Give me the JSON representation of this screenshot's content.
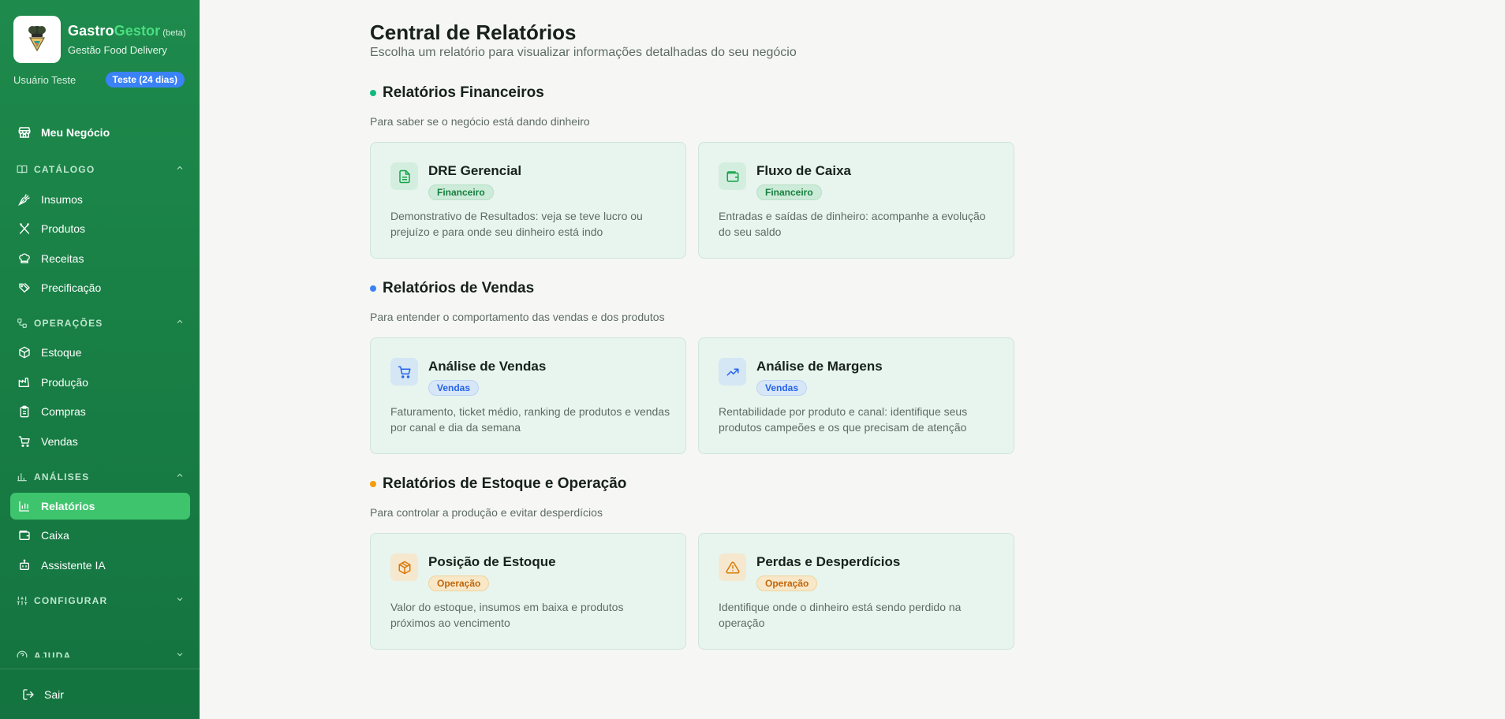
{
  "brand": {
    "name_part1": "Gastro",
    "name_part2": "Gestor",
    "beta": "(beta)",
    "subtitle": "Gestão Food Delivery"
  },
  "user": {
    "name": "Usuário Teste",
    "trial": "Teste (24 dias)"
  },
  "nav": {
    "home": "Meu Negócio",
    "catalog": {
      "title": "CATÁLOGO",
      "items": [
        "Insumos",
        "Produtos",
        "Receitas",
        "Precificação"
      ]
    },
    "operations": {
      "title": "OPERAÇÕES",
      "items": [
        "Estoque",
        "Produção",
        "Compras",
        "Vendas"
      ]
    },
    "analysis": {
      "title": "ANÁLISES",
      "items": [
        "Relatórios",
        "Caixa",
        "Assistente IA"
      ]
    },
    "configure": {
      "title": "CONFIGURAR"
    },
    "help": {
      "title": "AJUDA"
    },
    "logout": "Sair"
  },
  "page": {
    "title": "Central de Relatórios",
    "subtitle": "Escolha um relatório para visualizar informações detalhadas do seu negócio"
  },
  "sections": [
    {
      "title": "Relatórios Financeiros",
      "description": "Para saber se o negócio está dando dinheiro",
      "color": "#10b981",
      "cards": [
        {
          "title": "DRE Gerencial",
          "badge": "Financeiro",
          "description": "Demonstrativo de Resultados: veja se teve lucro ou prejuízo e para onde seu dinheiro está indo",
          "icon": "document-icon"
        },
        {
          "title": "Fluxo de Caixa",
          "badge": "Financeiro",
          "description": "Entradas e saídas de dinheiro: acompanhe a evolução do seu saldo",
          "icon": "wallet-icon"
        }
      ]
    },
    {
      "title": "Relatórios de Vendas",
      "description": "Para entender o comportamento das vendas e dos produtos",
      "color": "#3b82f6",
      "cards": [
        {
          "title": "Análise de Vendas",
          "badge": "Vendas",
          "description": "Faturamento, ticket médio, ranking de produtos e vendas por canal e dia da semana",
          "icon": "cart-icon"
        },
        {
          "title": "Análise de Margens",
          "badge": "Vendas",
          "description": "Rentabilidade por produto e canal: identifique seus produtos campeões e os que precisam de atenção",
          "icon": "trending-up-icon"
        }
      ]
    },
    {
      "title": "Relatórios de Estoque e Operação",
      "description": "Para controlar a produção e evitar desperdícios",
      "color": "#f59e0b",
      "cards": [
        {
          "title": "Posição de Estoque",
          "badge": "Operação",
          "description": "Valor do estoque, insumos em baixa e produtos próximos ao vencimento",
          "icon": "package-icon"
        },
        {
          "title": "Perdas e Desperdícios",
          "badge": "Operação",
          "description": "Identifique onde o dinheiro está sendo perdido na operação",
          "icon": "warning-icon"
        }
      ]
    }
  ]
}
